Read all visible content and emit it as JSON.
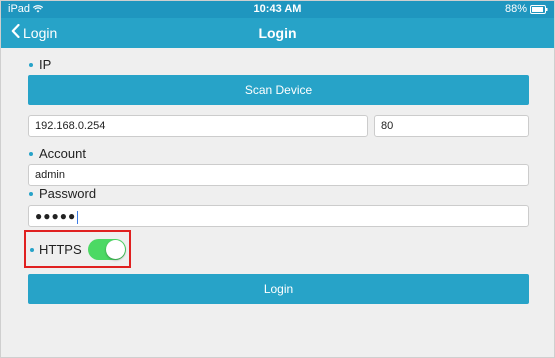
{
  "status_bar": {
    "device": "iPad",
    "time": "10:43 AM",
    "battery": "88%"
  },
  "nav": {
    "back_label": "Login",
    "title": "Login"
  },
  "form": {
    "ip_label": "IP",
    "scan_button": "Scan Device",
    "ip_value": "192.168.0.254",
    "port_value": "80",
    "account_label": "Account",
    "account_value": "admin",
    "password_label": "Password",
    "password_value": "●●●●●",
    "https_label": "HTTPS",
    "https_enabled": true,
    "login_button": "Login"
  },
  "colors": {
    "accent": "#27a3c8",
    "status_bar": "#1f96bf",
    "toggle_on": "#4cd964",
    "highlight": "#e02020"
  },
  "icons": [
    "wifi-icon",
    "battery-icon",
    "chevron-left-icon"
  ]
}
